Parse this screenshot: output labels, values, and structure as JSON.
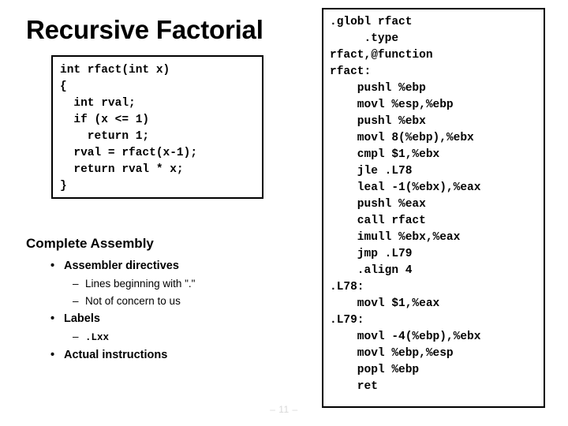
{
  "slide": {
    "title": "Recursive Factorial",
    "page_number": "– 11 –"
  },
  "c_source": {
    "lines": [
      "int rfact(int x)",
      "{",
      "  int rval;",
      "  if (x <= 1)",
      "    return 1;",
      "  rval = rfact(x-1);",
      "  return rval * x;",
      "}"
    ]
  },
  "assembly_section": {
    "heading": "Complete Assembly",
    "bullets": [
      {
        "level": 1,
        "marker": "•",
        "text": "Assembler directives"
      },
      {
        "level": 2,
        "marker": "–",
        "text": "Lines beginning with \"."
      },
      {
        "level": 2,
        "marker": "–",
        "text": "Not of concern to us"
      },
      {
        "level": 1,
        "marker": "•",
        "text": "Labels"
      },
      {
        "level": 2,
        "marker": "–",
        "text": ".Lxx"
      },
      {
        "level": 1,
        "marker": "•",
        "text": "Actual instructions"
      }
    ],
    "quote_suffix": "\""
  },
  "asm_listing": {
    "lines": [
      ".globl rfact",
      "     .type",
      "rfact,@function",
      "rfact:",
      "    pushl %ebp",
      "    movl %esp,%ebp",
      "    pushl %ebx",
      "    movl 8(%ebp),%ebx",
      "    cmpl $1,%ebx",
      "    jle .L78",
      "    leal -1(%ebx),%eax",
      "    pushl %eax",
      "    call rfact",
      "    imull %ebx,%eax",
      "    jmp .L79",
      "    .align 4",
      ".L78:",
      "    movl $1,%eax",
      ".L79:",
      "    movl -4(%ebp),%ebx",
      "    movl %ebp,%esp",
      "    popl %ebp",
      "    ret"
    ]
  },
  "colors": {
    "text": "#000000",
    "background": "#ffffff",
    "border": "#000000",
    "footer": "#d8d8d8"
  }
}
